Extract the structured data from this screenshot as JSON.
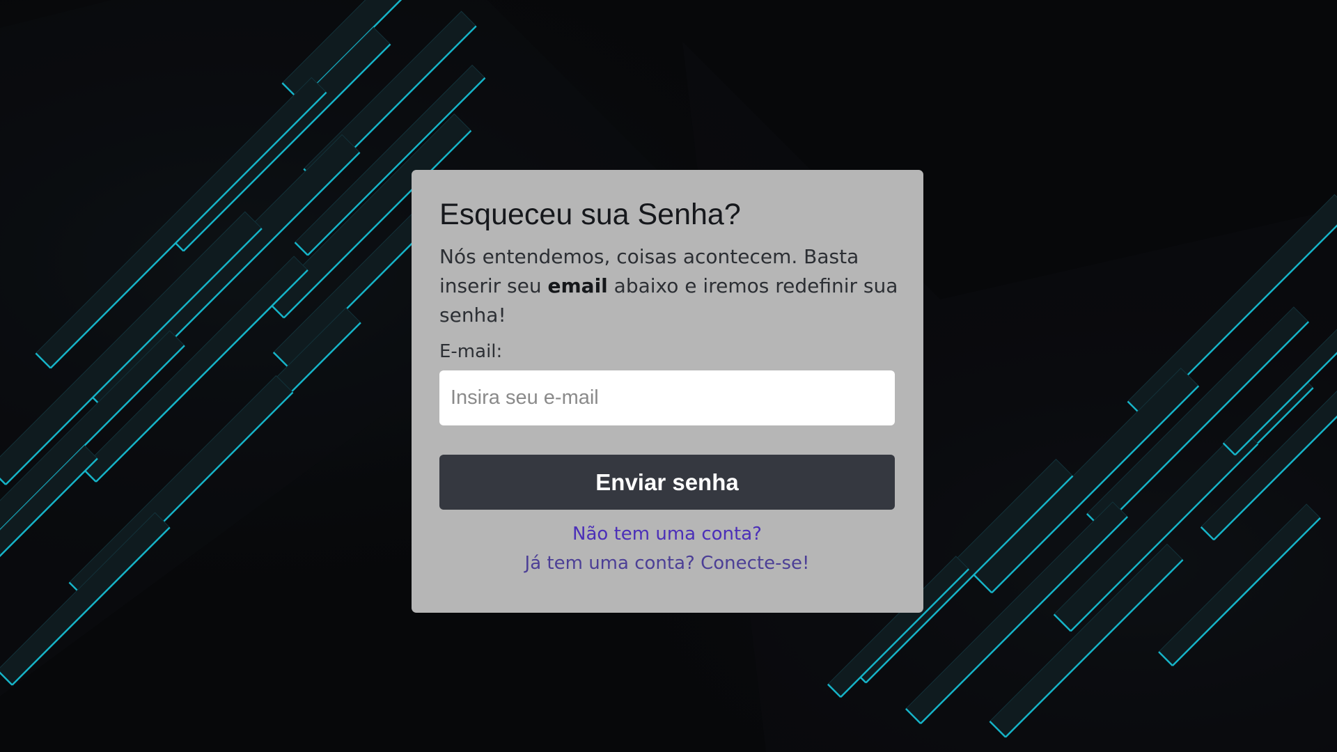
{
  "background": {
    "base_color": "#07080a",
    "accent_color": "#16b4c8"
  },
  "card": {
    "background_color": "#b6b6b6",
    "title": "Esqueceu sua Senha?",
    "description": {
      "before": "Nós entendemos, coisas acontecem. Basta inserir seu ",
      "bold": "email",
      "after": " abaixo e iremos redefinir sua senha!"
    },
    "email_label": "E-mail:",
    "email_input": {
      "value": "",
      "placeholder": "Insira seu e-mail"
    },
    "submit_label": "Enviar senha",
    "signup_link": "Não tem uma conta?",
    "login_link": "Já tem uma conta? Conecte-se!"
  }
}
